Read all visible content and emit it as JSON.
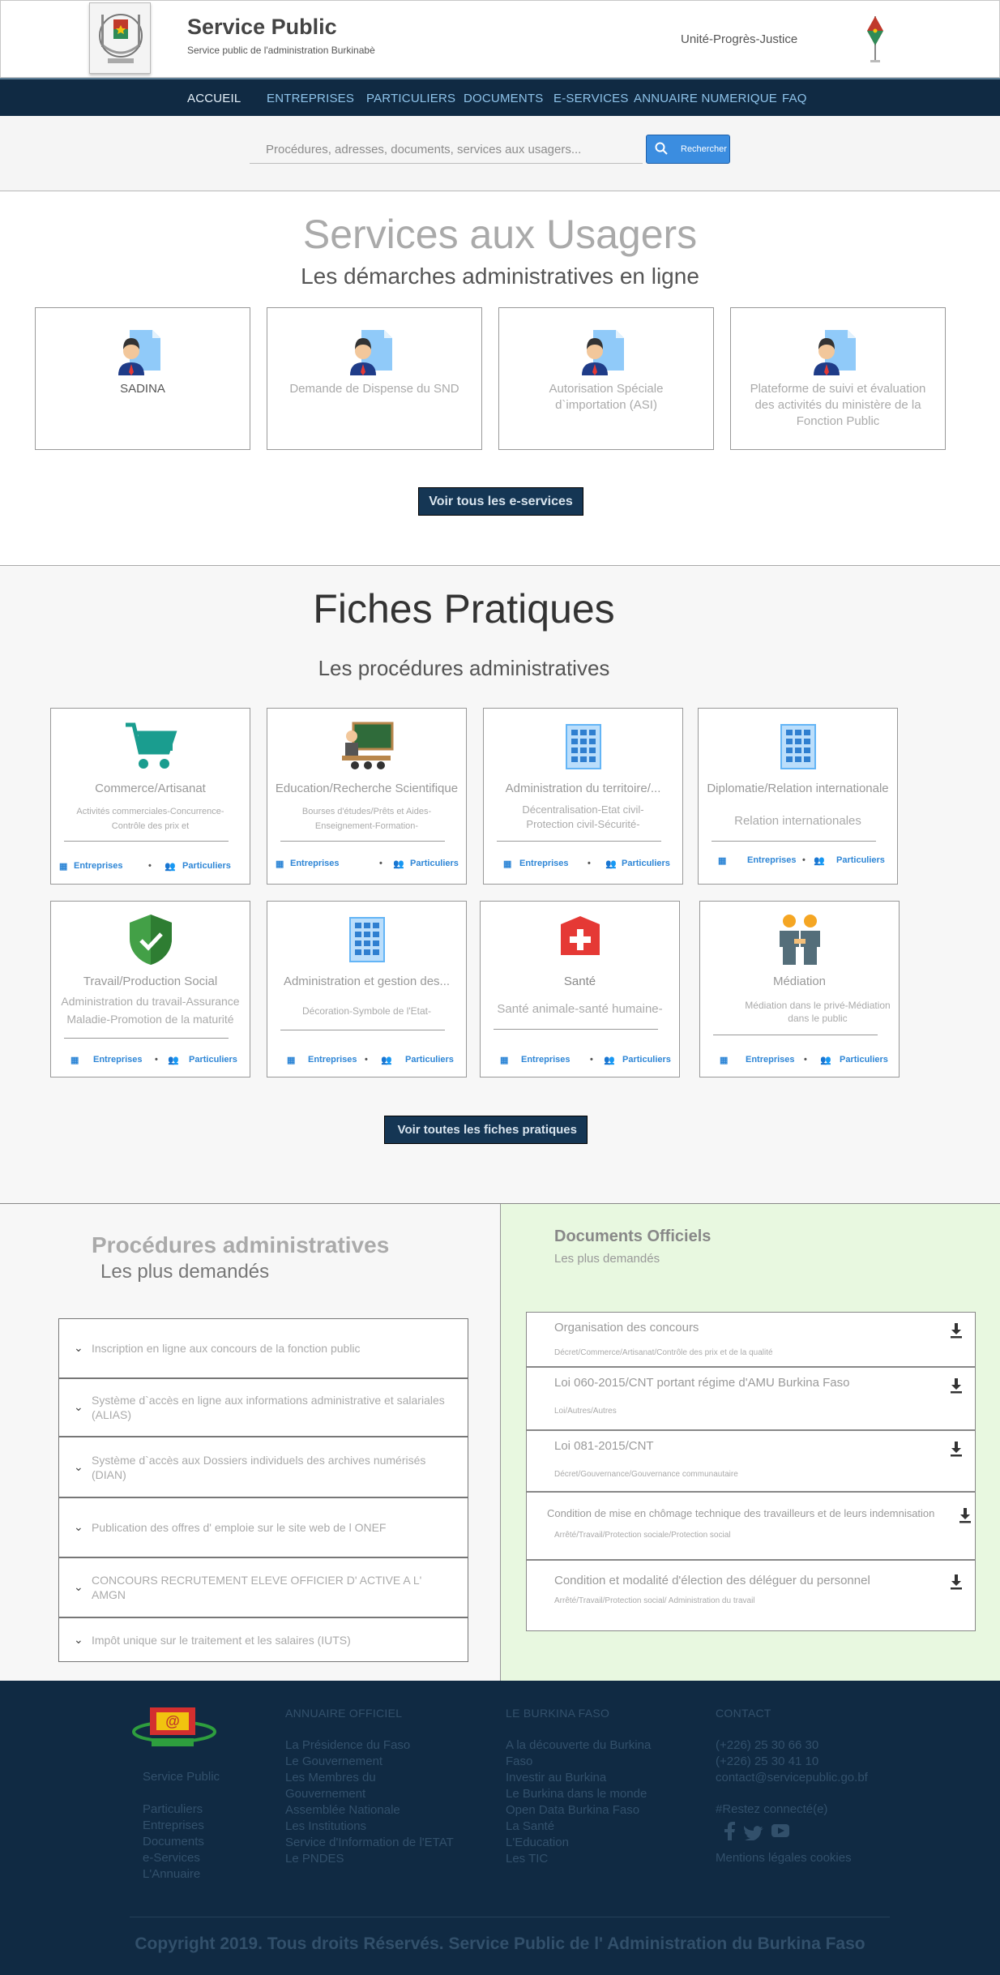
{
  "header": {
    "title": "Service Public",
    "subtitle": "Service public de l'administration Burkinabè",
    "motto": "Unité-Progrès-Justice"
  },
  "nav": {
    "items": [
      "ACCUEIL",
      "ENTREPRISES",
      "PARTICULIERS",
      "DOCUMENTS",
      "E-SERVICES",
      "ANNUAIRE NUMERIQUE",
      "FAQ"
    ]
  },
  "search": {
    "placeholder": "Procédures, adresses, documents, services aux usagers...",
    "button": "Rechercher"
  },
  "services": {
    "title": "Services aux Usagers",
    "subtitle": "Les démarches administratives en ligne",
    "cards": [
      "SADINA",
      "Demande de Dispense du SND",
      "Autorisation Spéciale d`importation (ASI)",
      "Plateforme de suivi et évaluation des activités du ministère de la Fonction Public"
    ],
    "button": "Voir tous les e-services"
  },
  "fiches": {
    "title": "Fiches Pratiques",
    "subtitle": "Les procédures administratives",
    "cards": [
      {
        "title": "Commerce/Artisanat",
        "sub": "Activités commerciales-Concurrence-Contrôle des prix et",
        "icon": "cart-icon"
      },
      {
        "title": "Education/Recherche Scientifique",
        "sub": "Bourses d'études/Prêts et Aides-Enseignement-Formation-",
        "icon": "teacher-icon"
      },
      {
        "title": "Administration du territoire/...",
        "sub": "Décentralisation-Etat civil-Protection civil-Sécurité-",
        "icon": "building-icon"
      },
      {
        "title": "Diplomatie/Relation internationale",
        "sub": "Relation internationales",
        "icon": "building-icon"
      },
      {
        "title": "Travail/Production Social",
        "sub": "Administration du travail-Assurance Maladie-Promotion de la maturité",
        "icon": "shield-check-icon"
      },
      {
        "title": "Administration et gestion des...",
        "sub": "Décoration-Symbole de l'Etat-",
        "icon": "building-icon"
      },
      {
        "title": "Santé",
        "sub": "Santé animale-santé humaine-",
        "icon": "health-cross-icon"
      },
      {
        "title": "Médiation",
        "sub": "Médiation dans le privé-Médiation dans le public",
        "icon": "people-icon"
      }
    ],
    "link_entreprises": "Entreprises",
    "link_particuliers": "Particuliers",
    "button": "Voir toutes les fiches pratiques"
  },
  "procedures": {
    "title": "Procédures administratives",
    "subtitle": "Les plus demandés",
    "items": [
      "Inscription en ligne aux concours de la fonction public",
      "Système d`accès en ligne aux informations administrative et salariales (ALIAS)",
      "Système d`accès aux Dossiers individuels des archives numérisés (DIAN)",
      "Publication des offres d' emploie sur le site web de l ONEF",
      "CONCOURS RECRUTEMENT  ELEVE OFFICIER D' ACTIVE A L' AMGN",
      "Impôt unique sur le traitement et les salaires (IUTS)"
    ]
  },
  "documents": {
    "title": "Documents  Officiels",
    "subtitle": "Les plus demandés",
    "items": [
      {
        "title": "Organisation des concours",
        "sub": "Décret/Commerce/Artisanat/Contrôle des prix et de la qualité"
      },
      {
        "title": "Loi 060-2015/CNT portant régime d'AMU Burkina Faso",
        "sub": "Loi/Autres/Autres"
      },
      {
        "title": "Loi 081-2015/CNT",
        "sub": "Décret/Gouvernance/Gouvernance communautaire"
      },
      {
        "title": "Condition de mise en chômage technique  des travailleurs  et de leurs indemnisation",
        "sub": "Arrêté/Travail/Protection sociale/Protection social"
      },
      {
        "title": "Condition et modalité d'élection des déléguer du personnel",
        "sub": "Arrêté/Travail/Protection social/ Administration du travail"
      }
    ]
  },
  "footer": {
    "brand": "Service Public",
    "brand_links": [
      "Particuliers",
      "Entreprises",
      "Documents",
      "e-Services",
      "L'Annuaire"
    ],
    "col1_title": "ANNUAIRE OFFICIEL",
    "col1": [
      "La Présidence du Faso",
      "Le Gouvernement",
      "Les Membres du",
      "Gouvernement",
      "Assemblée Nationale",
      "Les Institutions",
      "Service d'Information de l'ETAT",
      "Le PNDES"
    ],
    "col2_title": "LE BURKINA FASO",
    "col2": [
      "A la découverte du Burkina",
      "Faso",
      "Investir au Burkina",
      "Le Burkina dans le monde",
      "Open Data Burkina Faso",
      "La Santé",
      "L'Education",
      "Les TIC"
    ],
    "col3_title": "CONTACT",
    "col3": [
      "(+226) 25 30 66 30",
      "(+226) 25 30 41 10",
      "contact@servicepublic.go.bf"
    ],
    "social": "#Restez connecté(e)",
    "legal": "Mentions légales  cookies",
    "copyright": "Copyright  2019. Tous droits Réservés. Service Public de l' Administration du Burkina Faso"
  }
}
